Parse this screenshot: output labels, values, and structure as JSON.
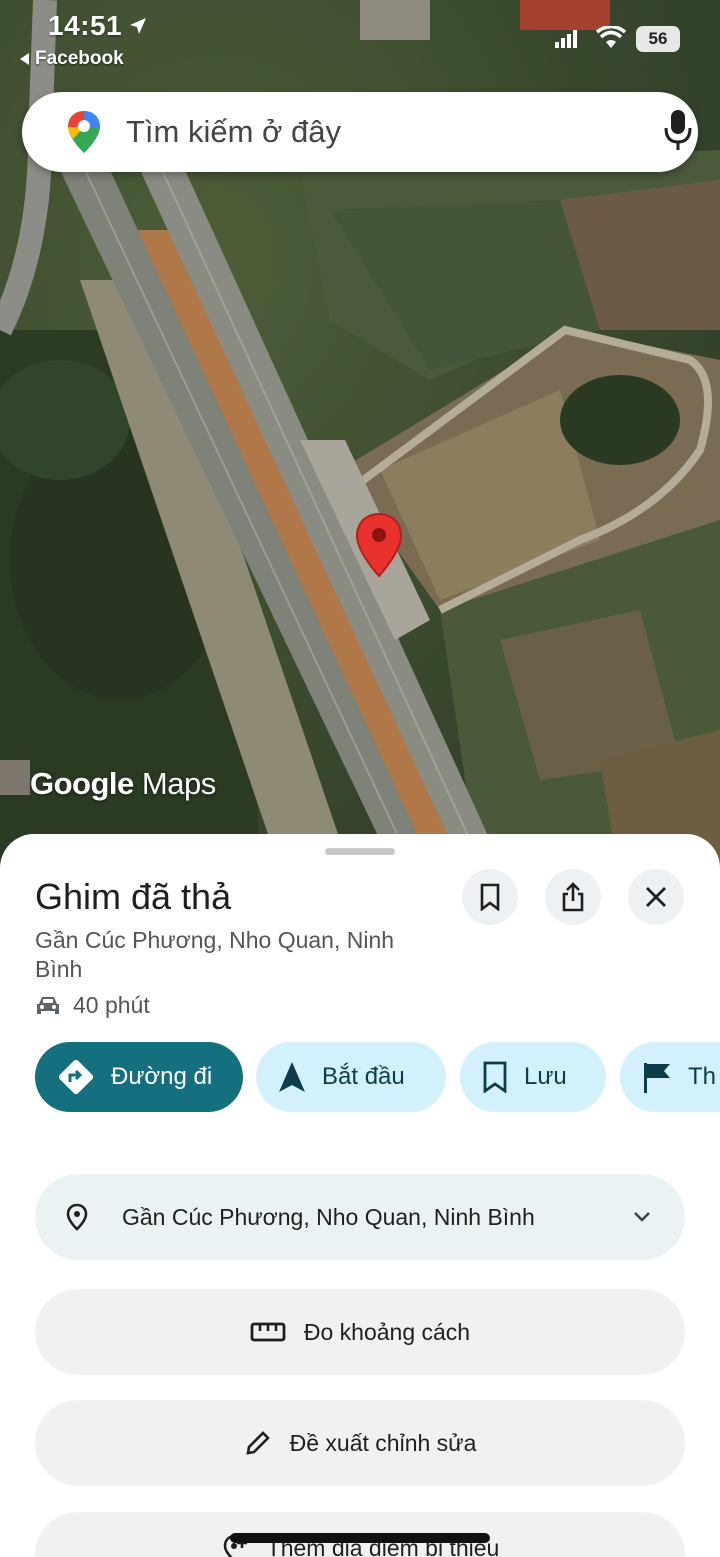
{
  "status_bar": {
    "time": "14:51",
    "back_app": "Facebook",
    "battery": "56"
  },
  "search": {
    "placeholder": "Tìm kiếm ở đây"
  },
  "map": {
    "watermark_bold": "Google",
    "watermark_light": " Maps"
  },
  "place": {
    "title": "Ghim đã thả",
    "address_short": "Gần Cúc Phương, Nho Quan, Ninh Bình",
    "drive_time": "40 phút"
  },
  "chips": {
    "directions": "Đường đi",
    "start": "Bắt đầu",
    "save": "Lưu",
    "more": "Th"
  },
  "rows": {
    "address_full": "Gần Cúc Phương, Nho Quan, Ninh Bình",
    "measure": "Đo khoảng cách",
    "suggest_edit": "Đề xuất chỉnh sửa",
    "add_place": "Thêm địa điểm bị thiếu"
  },
  "colors": {
    "primary_chip": "#14707e",
    "secondary_chip": "#d3f1fb",
    "pin_red": "#e8322b"
  }
}
